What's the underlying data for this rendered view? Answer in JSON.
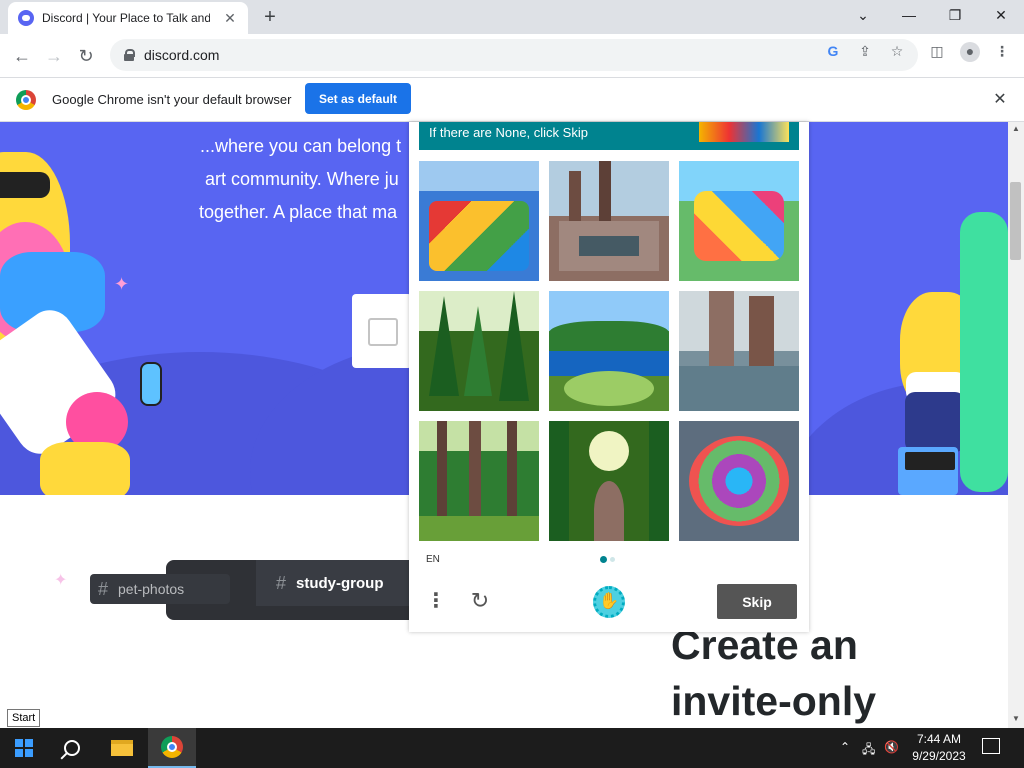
{
  "browser": {
    "tab_title": "Discord | Your Place to Talk and Hang Out",
    "tab_close": "✕",
    "new_tab": "+",
    "url": "discord.com",
    "window_controls": {
      "dropdown": "⌄",
      "minimize": "—",
      "restore": "❐",
      "close": "✕"
    }
  },
  "infobar": {
    "message": "Google Chrome isn't your default browser",
    "button": "Set as default",
    "close": "✕"
  },
  "hero": {
    "line1": "...where you can belong t",
    "line2": "art community. Where ju",
    "line3": "together. A place that ma"
  },
  "captcha": {
    "header": "If there are None, click Skip",
    "lang": "EN",
    "skip": "Skip",
    "tiles": [
      "colorful-amusement-park-1",
      "industrial-factory-1",
      "colorful-amusement-park-2",
      "pine-forest-1",
      "lake-landscape",
      "industrial-factory-2",
      "redwood-forest",
      "forest-path",
      "colorful-amusement-park-3"
    ]
  },
  "lower": {
    "heading_line1": "Create an",
    "heading_line2": "invite-only",
    "channel_pet": "pet-photos",
    "channel_study": "study-group"
  },
  "taskbar": {
    "start_tooltip": "Start",
    "time": "7:44 AM",
    "date": "9/29/2023"
  },
  "colors": {
    "discord_blurple": "#5865f2",
    "captcha_teal": "#00838f",
    "chrome_blue": "#1a73e8"
  }
}
